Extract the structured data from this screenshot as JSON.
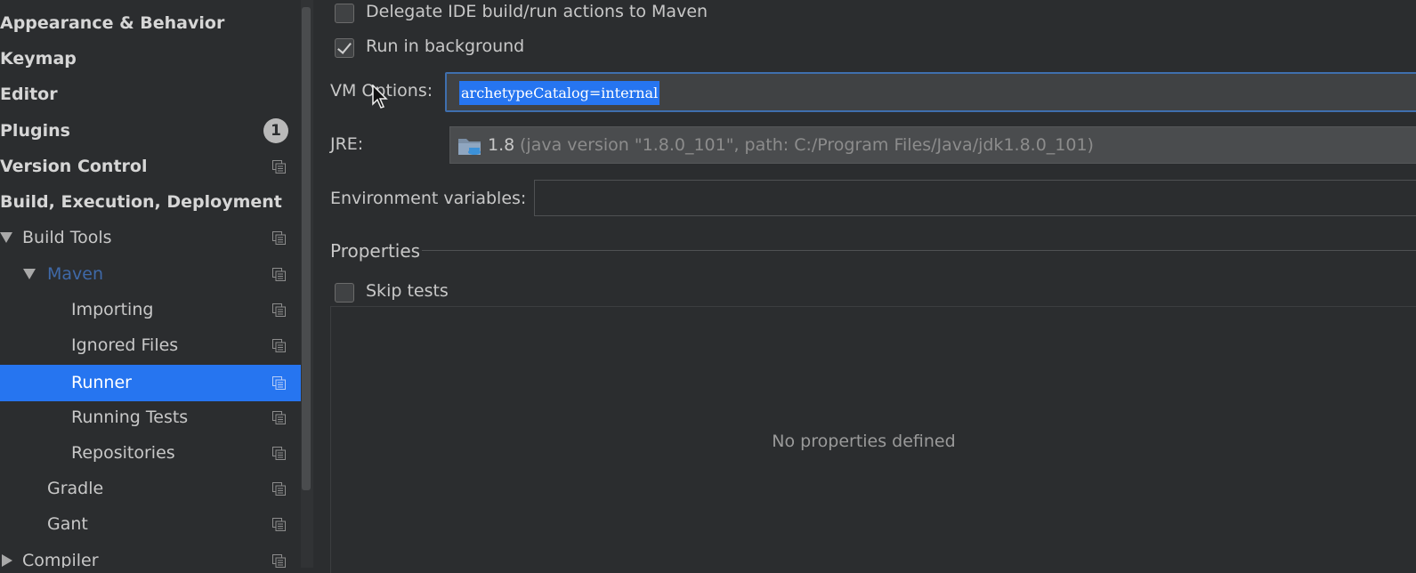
{
  "sidebar": {
    "items": [
      {
        "label": "Appearance & Behavior"
      },
      {
        "label": "Keymap"
      },
      {
        "label": "Editor"
      },
      {
        "label": "Plugins",
        "badge": "1"
      },
      {
        "label": "Version Control"
      },
      {
        "label": "Build, Execution, Deployment"
      },
      {
        "label": "Build Tools"
      },
      {
        "label": "Maven"
      },
      {
        "label": "Importing"
      },
      {
        "label": "Ignored Files"
      },
      {
        "label": "Runner",
        "selected": true
      },
      {
        "label": "Running Tests"
      },
      {
        "label": "Repositories"
      },
      {
        "label": "Gradle"
      },
      {
        "label": "Gant"
      },
      {
        "label": "Compiler"
      }
    ]
  },
  "runner": {
    "delegate_label": "Delegate IDE build/run actions to Maven",
    "delegate_checked": false,
    "background_label": "Run in background",
    "background_checked": true,
    "vm_options_label": "VM Options:",
    "vm_options_value": "archetypeCatalog=internal",
    "jre_label": "JRE:",
    "jre_version": "1.8",
    "jre_detail": "(java version \"1.8.0_101\", path: C:/Program Files/Java/jdk1.8.0_101)",
    "env_label": "Environment variables:",
    "env_value": "",
    "properties_title": "Properties",
    "skip_tests_label": "Skip tests",
    "skip_tests_checked": false,
    "empty_properties": "No properties defined"
  },
  "colors": {
    "background": "#2b2d2f",
    "selection": "#2675f0",
    "maven_label": "#3f69a8",
    "focus_border": "#3f6fae"
  },
  "icons": [
    "copy-icon",
    "folder-icon",
    "chevron-down-icon",
    "chevron-right-icon",
    "mouse-cursor-icon"
  ]
}
